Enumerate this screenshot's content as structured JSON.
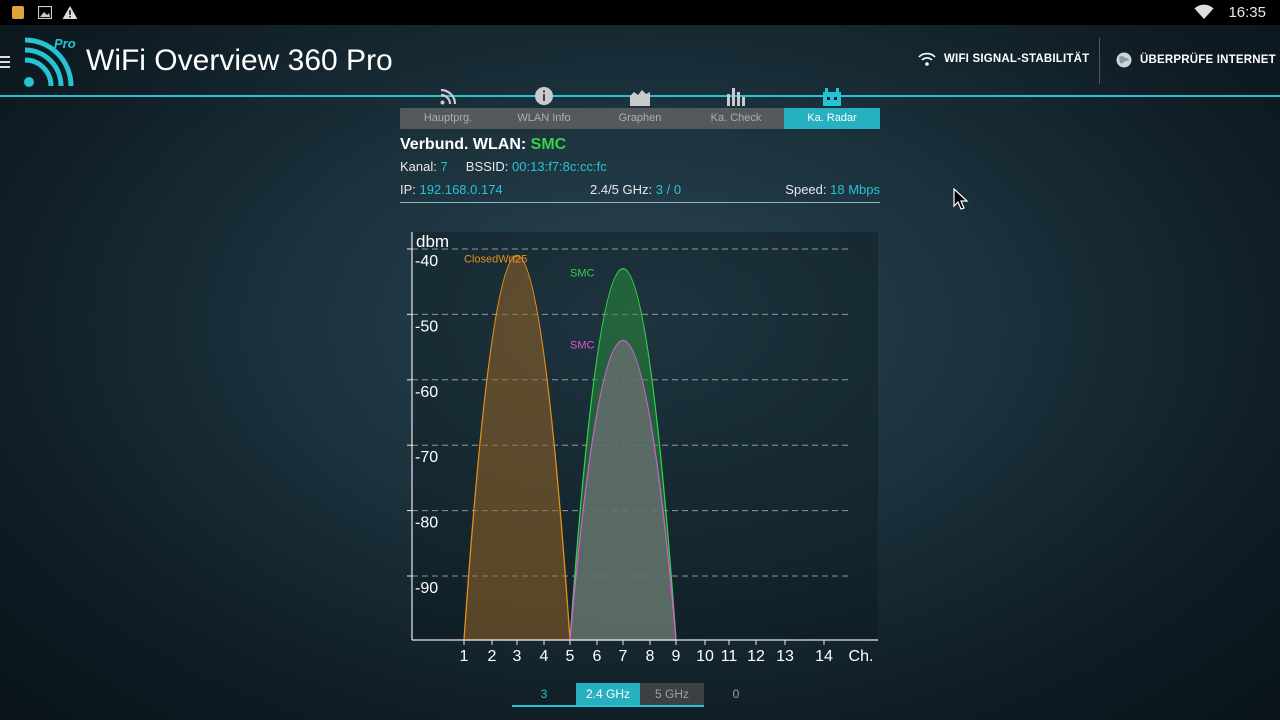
{
  "status_bar": {
    "time": "16:35"
  },
  "app": {
    "title": "WiFi Overview 360 Pro",
    "logo_badge": "Pro"
  },
  "actions": {
    "signal_stability": "WIFI SIGNAL-STABILITÄT",
    "check_internet": "ÜBERPRÜFE INTERNET"
  },
  "tabs": [
    {
      "label": "Hauptprg.",
      "icon": "wifi-icon",
      "active": false
    },
    {
      "label": "WLAN Info",
      "icon": "info-icon",
      "active": false
    },
    {
      "label": "Graphen",
      "icon": "graph-icon",
      "active": false
    },
    {
      "label": "Ka. Check",
      "icon": "bar-chart-icon",
      "active": false
    },
    {
      "label": "Ka. Radar",
      "icon": "radar-icon",
      "active": true
    }
  ],
  "connection": {
    "label": "Verbund. WLAN:",
    "ssid": "SMC",
    "channel_label": "Kanal:",
    "channel": "7",
    "bssid_label": "BSSID:",
    "bssid": "00:13:f7:8c:cc:fc",
    "ip_label": "IP:",
    "ip": "192.168.0.174",
    "band_label": "2.4/5 GHz:",
    "band": "3 / 0",
    "speed_label": "Speed:",
    "speed": "18 Mbps"
  },
  "colors": {
    "accent": "#27c3d2",
    "connected": "#36d24a",
    "orange": "#e8901a",
    "magenta": "#d85ad0"
  },
  "chart_data": {
    "type": "area",
    "ylabel": "dbm",
    "xlabel": "Ch.",
    "y_ticks": [
      "-40",
      "-50",
      "-60",
      "-70",
      "-80",
      "-90"
    ],
    "x_ticks": [
      "1",
      "2",
      "3",
      "4",
      "5",
      "6",
      "7",
      "8",
      "9",
      "10",
      "11",
      "12",
      "13",
      "14"
    ],
    "ylim": [
      -100,
      -38
    ],
    "grid": true,
    "series": [
      {
        "name": "ClosedWrt25",
        "channel_center": 3,
        "channel_start": 1,
        "channel_end": 5,
        "peak_dbm": -41,
        "color": "#e8901a"
      },
      {
        "name": "SMC",
        "channel_center": 7,
        "channel_start": 5,
        "channel_end": 9,
        "peak_dbm": -43,
        "color": "#36d24a"
      },
      {
        "name": "SMC",
        "channel_center": 7,
        "channel_start": 5,
        "channel_end": 9,
        "peak_dbm": -54,
        "color": "#d85ad0"
      }
    ]
  },
  "band_selector": {
    "count_24": "3",
    "label_24": "2.4 GHz",
    "label_5": "5 GHz",
    "count_5": "0"
  }
}
